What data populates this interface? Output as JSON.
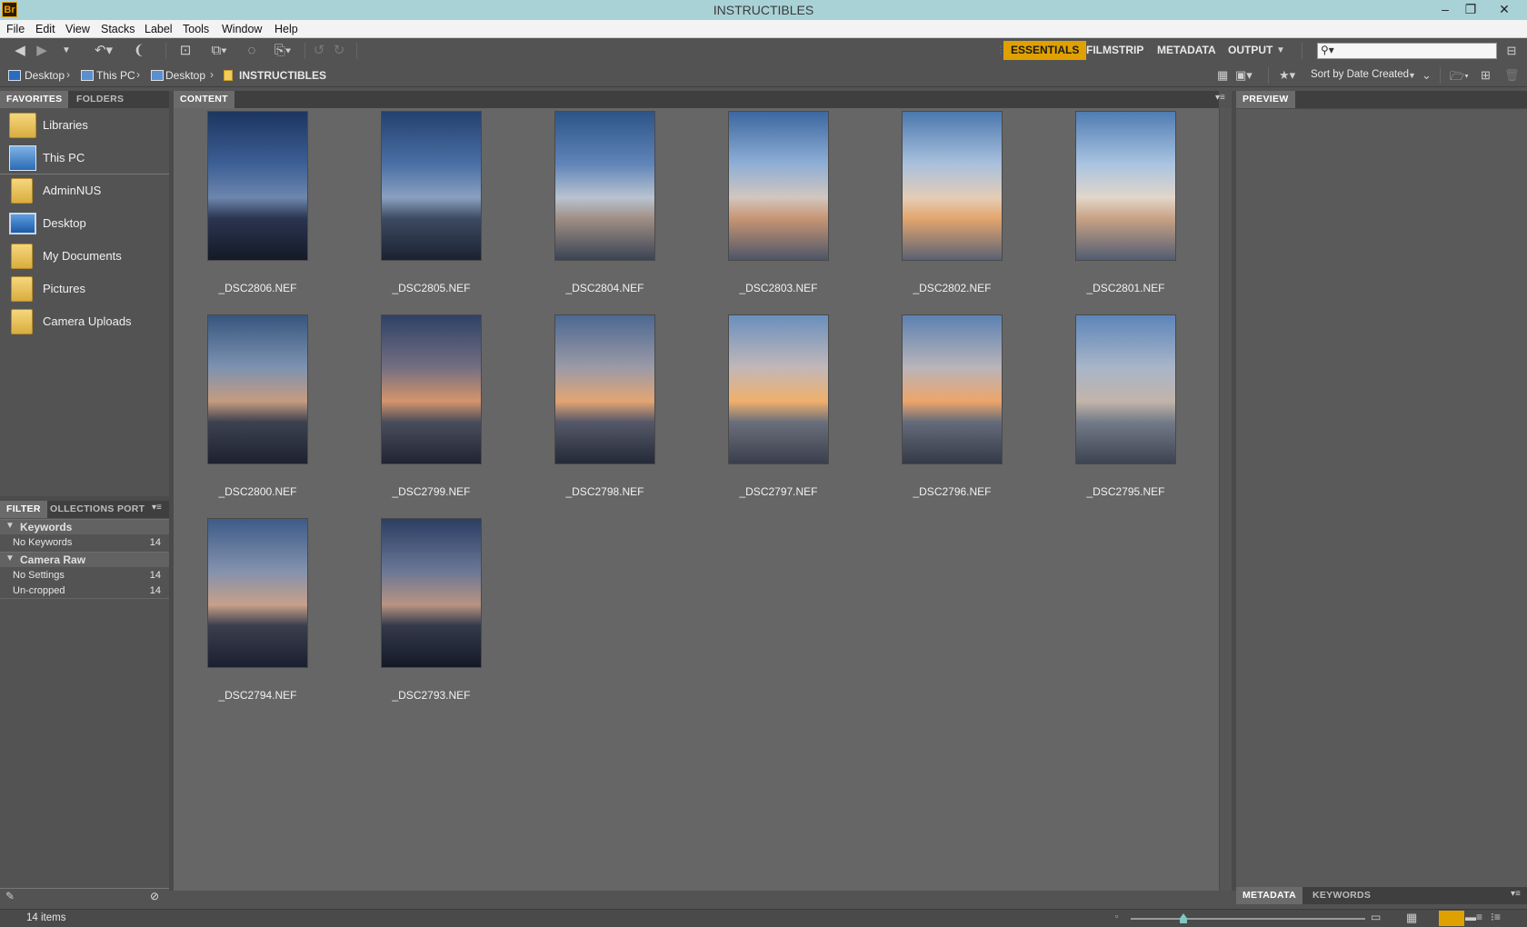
{
  "window": {
    "app_icon": "Br",
    "title": "INSTRUCTIBLES",
    "controls": [
      "minimize-icon",
      "restore-icon",
      "close-icon"
    ]
  },
  "menu": [
    "File",
    "Edit",
    "View",
    "Stacks",
    "Label",
    "Tools",
    "Window",
    "Help"
  ],
  "workspaces": {
    "essentials": "ESSENTIALS",
    "filmstrip": "FILMSTRIP",
    "metadata": "METADATA",
    "output": "OUTPUT"
  },
  "search": {
    "value": ""
  },
  "breadcrumb": [
    "Desktop",
    "This PC",
    "Desktop",
    "INSTRUCTIBLES"
  ],
  "sort": {
    "label": "Sort by Date Created"
  },
  "left_panel": {
    "tabs": [
      "FAVORITES",
      "FOLDERS"
    ],
    "favorites": [
      {
        "label": "Libraries",
        "icon": "libraries-icon"
      },
      {
        "label": "This PC",
        "icon": "computer-icon"
      },
      {
        "label": "AdminNUS",
        "icon": "user-folder-icon"
      },
      {
        "label": "Desktop",
        "icon": "desktop-icon"
      },
      {
        "label": "My Documents",
        "icon": "documents-folder-icon"
      },
      {
        "label": "Pictures",
        "icon": "pictures-folder-icon"
      },
      {
        "label": "Camera Uploads",
        "icon": "camera-folder-icon"
      }
    ]
  },
  "filter_panel": {
    "tabs": [
      "FILTER",
      "OLLECTIONS",
      "PORT"
    ],
    "groups": [
      {
        "label": "Keywords",
        "rows": [
          {
            "label": "No Keywords",
            "count": "14"
          }
        ]
      },
      {
        "label": "Camera Raw",
        "rows": [
          {
            "label": "No Settings",
            "count": "14"
          },
          {
            "label": "Un-cropped",
            "count": "14"
          }
        ]
      }
    ]
  },
  "content": {
    "tab": "CONTENT",
    "thumbnails": [
      {
        "name": "_DSC2806.NEF"
      },
      {
        "name": "_DSC2805.NEF"
      },
      {
        "name": "_DSC2804.NEF"
      },
      {
        "name": "_DSC2803.NEF"
      },
      {
        "name": "_DSC2802.NEF"
      },
      {
        "name": "_DSC2801.NEF"
      },
      {
        "name": "_DSC2800.NEF"
      },
      {
        "name": "_DSC2799.NEF"
      },
      {
        "name": "_DSC2798.NEF"
      },
      {
        "name": "_DSC2797.NEF"
      },
      {
        "name": "_DSC2796.NEF"
      },
      {
        "name": "_DSC2795.NEF"
      },
      {
        "name": "_DSC2794.NEF"
      },
      {
        "name": "_DSC2793.NEF"
      }
    ]
  },
  "right_panel": {
    "top_tab": "PREVIEW",
    "bottom_tabs": [
      "METADATA",
      "KEYWORDS"
    ]
  },
  "status": {
    "items": "14 items"
  }
}
